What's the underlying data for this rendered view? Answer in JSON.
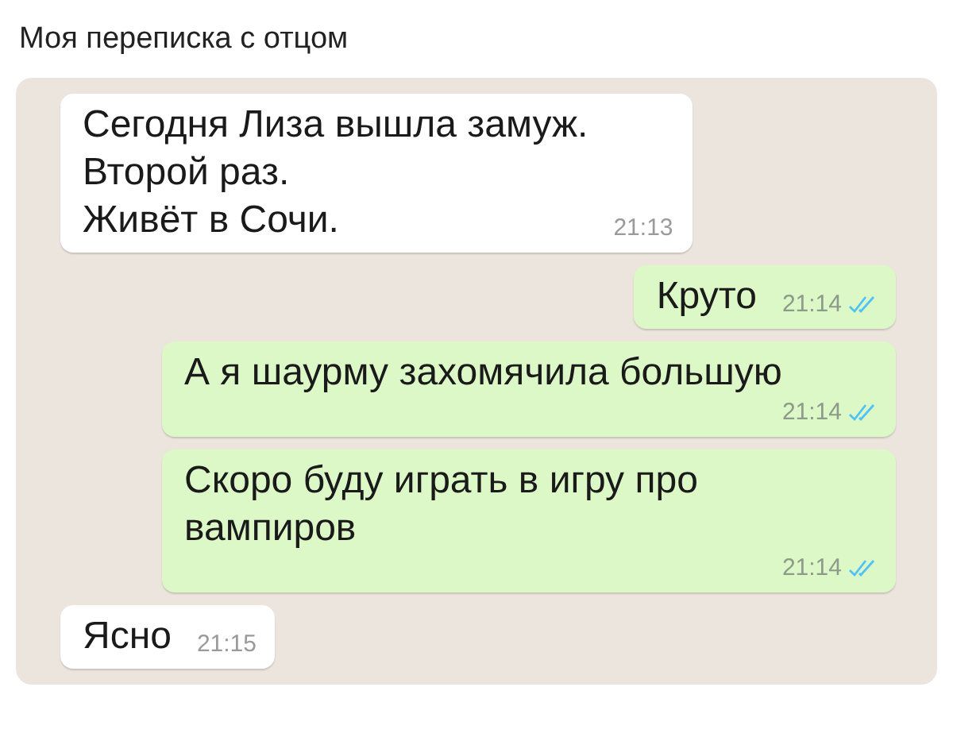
{
  "caption": "Моя переписка с отцом",
  "messages": [
    {
      "kind": "incoming",
      "text": "Сегодня Лиза вышла замуж.\nВторой раз.\nЖивёт в Сочи.",
      "time": "21:13"
    },
    {
      "kind": "outgoing",
      "text": "Круто",
      "time": "21:14",
      "read": true
    },
    {
      "kind": "outgoing",
      "text": "А я шаурму захомячила большую",
      "time": "21:14",
      "read": true
    },
    {
      "kind": "outgoing",
      "text": "Скоро буду играть в игру про вампиров",
      "time": "21:14",
      "read": true
    },
    {
      "kind": "incoming",
      "text": "Ясно",
      "time": "21:15"
    }
  ]
}
